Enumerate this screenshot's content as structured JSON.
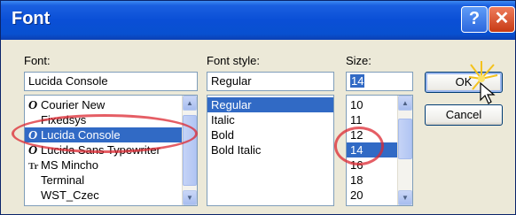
{
  "window": {
    "title": "Font",
    "help_glyph": "?",
    "close_glyph": "✕"
  },
  "font": {
    "label": "Font:",
    "value": "Lucida Console",
    "items": [
      {
        "icon": "O",
        "label": "Courier New",
        "selected": false
      },
      {
        "icon": "",
        "label": "Fixedsys",
        "selected": false
      },
      {
        "icon": "O",
        "label": "Lucida Console",
        "selected": true
      },
      {
        "icon": "O",
        "label": "Lucida Sans Typewriter",
        "selected": false
      },
      {
        "icon": "Tr",
        "label": "MS Mincho",
        "selected": false
      },
      {
        "icon": "",
        "label": "Terminal",
        "selected": false
      },
      {
        "icon": "",
        "label": "WST_Czec",
        "selected": false
      }
    ]
  },
  "style": {
    "label": "Font style:",
    "value": "Regular",
    "items": [
      {
        "label": "Regular",
        "selected": true
      },
      {
        "label": "Italic",
        "selected": false
      },
      {
        "label": "Bold",
        "selected": false
      },
      {
        "label": "Bold Italic",
        "selected": false
      }
    ]
  },
  "size": {
    "label": "Size:",
    "value": "14",
    "items": [
      {
        "label": "10",
        "selected": false
      },
      {
        "label": "11",
        "selected": false
      },
      {
        "label": "12",
        "selected": false
      },
      {
        "label": "14",
        "selected": true
      },
      {
        "label": "16",
        "selected": false
      },
      {
        "label": "18",
        "selected": false
      },
      {
        "label": "20",
        "selected": false
      }
    ]
  },
  "buttons": {
    "ok": "OK",
    "cancel": "Cancel"
  },
  "colors": {
    "title_bar": "#0a4fd6",
    "selection": "#316ac5",
    "annotation": "#dc2832"
  }
}
